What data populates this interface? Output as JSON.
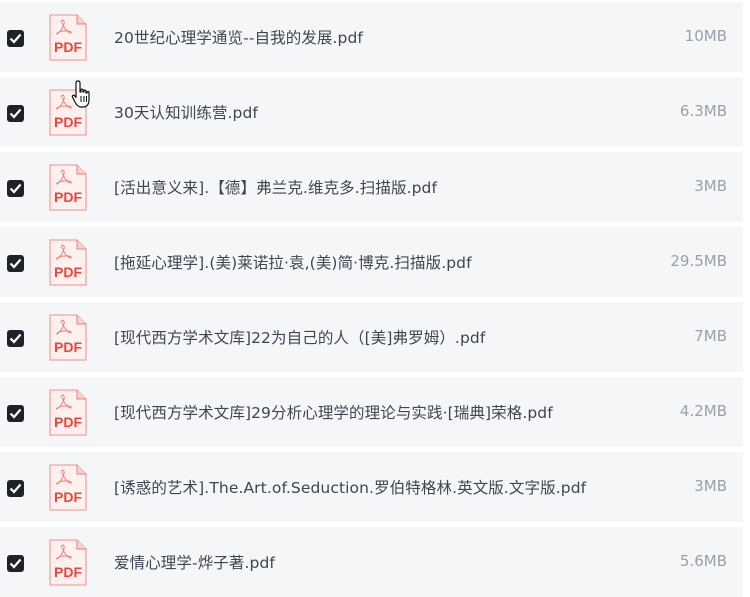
{
  "files": [
    {
      "name": "20世纪心理学通览--自我的发展.pdf",
      "size": "10MB",
      "icon": "pdf-file-icon",
      "checked": true
    },
    {
      "name": "30天认知训练营.pdf",
      "size": "6.3MB",
      "icon": "pdf-file-icon",
      "checked": true
    },
    {
      "name": "[活出意义来].【德】弗兰克.维克多.扫描版.pdf",
      "size": "3MB",
      "icon": "pdf-file-icon",
      "checked": true
    },
    {
      "name": "[拖延心理学].(美)莱诺拉·袁,(美)简·博克.扫描版.pdf",
      "size": "29.5MB",
      "icon": "pdf-file-icon",
      "checked": true
    },
    {
      "name": "[现代西方学术文库]22为自己的人（[美]弗罗姆）.pdf",
      "size": "7MB",
      "icon": "pdf-file-icon",
      "checked": true
    },
    {
      "name": "[现代西方学术文库]29分析心理学的理论与实践·[瑞典]荣格.pdf",
      "size": "4.2MB",
      "icon": "pdf-file-icon",
      "checked": true
    },
    {
      "name": "[诱惑的艺术].The.Art.of.Seduction.罗伯特格林.英文版.文字版.pdf",
      "size": "3MB",
      "icon": "pdf-file-icon",
      "checked": true
    },
    {
      "name": "爱情心理学-烨子著.pdf",
      "size": "5.6MB",
      "icon": "pdf-file-icon",
      "checked": true
    }
  ],
  "pdf_badge_text": "PDF",
  "colors": {
    "row_bg": "#f5f6f8",
    "checkbox": "#1f2329",
    "pdf_red": "#e8453c",
    "text": "#404552",
    "size_text": "#9aa0a8"
  }
}
